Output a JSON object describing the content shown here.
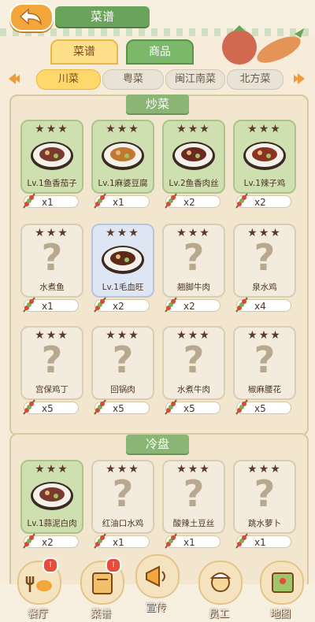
{
  "header": {
    "title": "菜谱"
  },
  "top_tabs": [
    {
      "label": "菜谱"
    },
    {
      "label": "商品"
    }
  ],
  "region_tabs": [
    {
      "label": "川菜"
    },
    {
      "label": "粤菜"
    },
    {
      "label": "闽江南菜"
    },
    {
      "label": "北方菜"
    }
  ],
  "sections": [
    {
      "title": "炒菜",
      "dishes": [
        {
          "name": "Lv.1鱼香茄子",
          "count": "x1",
          "stars": "★★★",
          "state": "learned"
        },
        {
          "name": "Lv.1麻婆豆腐",
          "count": "x1",
          "stars": "★★★",
          "state": "learned"
        },
        {
          "name": "Lv.2鱼香肉丝",
          "count": "x2",
          "stars": "★★★",
          "state": "learned"
        },
        {
          "name": "Lv.1辣子鸡",
          "count": "x2",
          "stars": "★★★",
          "state": "learned"
        },
        {
          "name": "水煮鱼",
          "count": "x1",
          "stars": "★★★",
          "state": "locked"
        },
        {
          "name": "Lv.1毛血旺",
          "count": "x2",
          "stars": "★★★",
          "state": "new"
        },
        {
          "name": "翘脚牛肉",
          "count": "x2",
          "stars": "★★★",
          "state": "locked"
        },
        {
          "name": "泉水鸡",
          "count": "x4",
          "stars": "★★★",
          "state": "locked"
        },
        {
          "name": "宫保鸡丁",
          "count": "x5",
          "stars": "★★★",
          "state": "locked"
        },
        {
          "name": "回锅肉",
          "count": "x5",
          "stars": "★★★",
          "state": "locked"
        },
        {
          "name": "水煮牛肉",
          "count": "x5",
          "stars": "★★★",
          "state": "locked"
        },
        {
          "name": "椒麻腰花",
          "count": "x5",
          "stars": "★★★",
          "state": "locked"
        }
      ]
    },
    {
      "title": "冷盘",
      "dishes": [
        {
          "name": "Lv.1蒜泥白肉",
          "count": "x2",
          "stars": "★★★",
          "state": "learned"
        },
        {
          "name": "红油口水鸡",
          "count": "x1",
          "stars": "★★★",
          "state": "locked"
        },
        {
          "name": "酸辣土豆丝",
          "count": "x1",
          "stars": "★★★",
          "state": "locked"
        },
        {
          "name": "跳水萝卜",
          "count": "x1",
          "stars": "★★★",
          "state": "locked"
        }
      ]
    }
  ],
  "bottom_nav": [
    {
      "label": "餐厅",
      "icon": "restaurant-icon",
      "badge": "!"
    },
    {
      "label": "菜谱",
      "icon": "recipe-icon",
      "badge": "!"
    },
    {
      "label": "宣传",
      "icon": "megaphone-icon"
    },
    {
      "label": "员工",
      "icon": "staff-icon"
    },
    {
      "label": "地图",
      "icon": "map-icon"
    }
  ],
  "colors": {
    "accent_green": "#6aa35a",
    "tab_yellow": "#ffd86b",
    "card_learned": "#cfe0b0",
    "card_locked": "#f3ecde",
    "star_brown": "#5a3a2a"
  }
}
